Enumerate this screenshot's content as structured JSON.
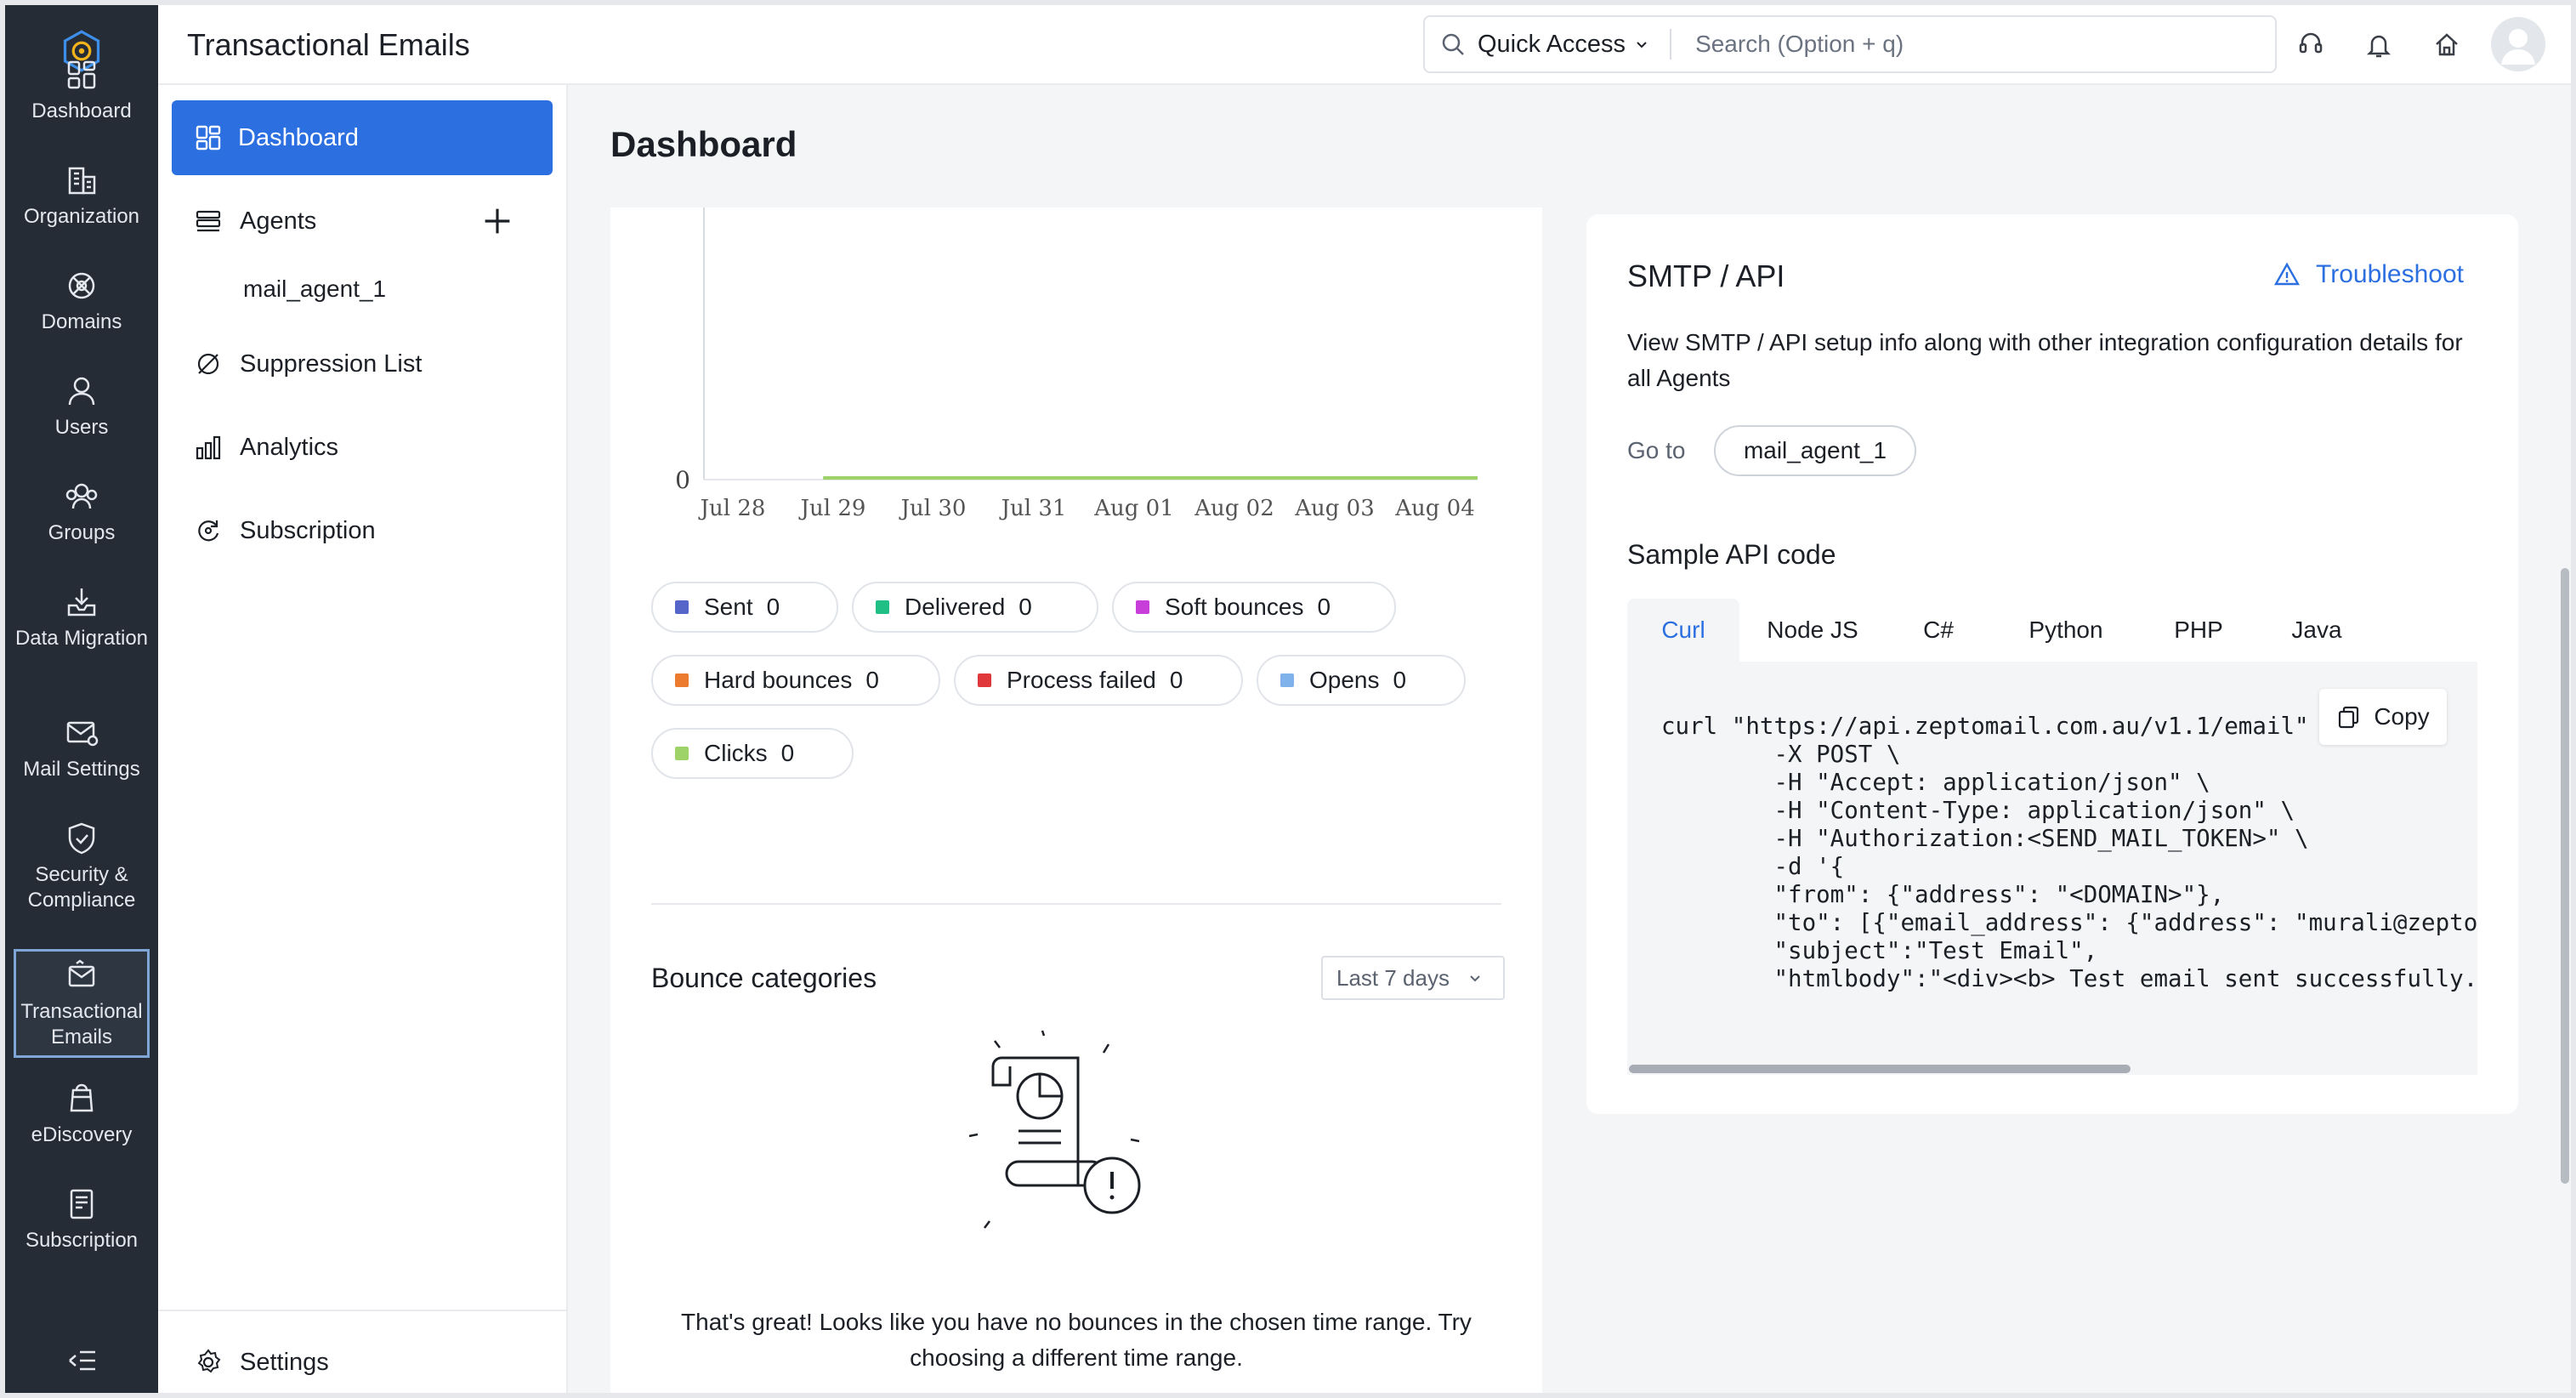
{
  "header": {
    "title": "Transactional Emails",
    "quick_access": "Quick Access",
    "search_placeholder": "Search (Option + q)"
  },
  "rail": {
    "items": [
      {
        "label": "Dashboard",
        "icon": "dashboard-icon"
      },
      {
        "label": "Organization",
        "icon": "organization-icon"
      },
      {
        "label": "Domains",
        "icon": "domains-icon"
      },
      {
        "label": "Users",
        "icon": "users-icon"
      },
      {
        "label": "Groups",
        "icon": "groups-icon"
      },
      {
        "label": "Data Migration",
        "icon": "data-migration-icon"
      },
      {
        "label": "Mail Settings",
        "icon": "mail-settings-icon"
      },
      {
        "label": "Security & Compliance",
        "icon": "security-icon"
      },
      {
        "label": "Transactional Emails",
        "icon": "transactional-emails-icon",
        "active": true
      },
      {
        "label": "eDiscovery",
        "icon": "ediscovery-icon"
      },
      {
        "label": "Subscription",
        "icon": "subscription-icon"
      }
    ]
  },
  "subnav": {
    "dashboard": "Dashboard",
    "agents": "Agents",
    "agent_1": "mail_agent_1",
    "suppression": "Suppression List",
    "analytics": "Analytics",
    "subscription": "Subscription",
    "settings": "Settings"
  },
  "main": {
    "title": "Dashboard"
  },
  "chart_data": {
    "type": "line",
    "categories": [
      "Jul 28",
      "Jul 29",
      "Jul 30",
      "Jul 31",
      "Aug 01",
      "Aug 02",
      "Aug 03",
      "Aug 04"
    ],
    "y_tick_labels": [
      "0"
    ],
    "series": [
      {
        "name": "Clicks",
        "color": "#9ed36a",
        "values": [
          null,
          0,
          0,
          0,
          0,
          0,
          0,
          0
        ]
      }
    ],
    "legend": [
      {
        "name": "Sent",
        "count": "0",
        "color": "#5566c8"
      },
      {
        "name": "Delivered",
        "count": "0",
        "color": "#1fbf86"
      },
      {
        "name": "Soft bounces",
        "count": "0",
        "color": "#c73ed8"
      },
      {
        "name": "Hard bounces",
        "count": "0",
        "color": "#ec7a2f"
      },
      {
        "name": "Process failed",
        "count": "0",
        "color": "#e0383a"
      },
      {
        "name": "Opens",
        "count": "0",
        "color": "#7fb2ea"
      },
      {
        "name": "Clicks",
        "count": "0",
        "color": "#9ed36a"
      }
    ]
  },
  "bounce": {
    "title": "Bounce categories",
    "range": "Last 7 days",
    "empty_message": "That's great! Looks like you have no bounces in the chosen time range. Try choosing a different time range."
  },
  "smtp": {
    "title": "SMTP / API",
    "troubleshoot": "Troubleshoot",
    "description": "View SMTP / API setup info along with other integration configuration details for all Agents",
    "goto_label": "Go to",
    "agent_chip": "mail_agent_1",
    "sample_title": "Sample API code",
    "tabs": [
      "Curl",
      "Node JS",
      "C#",
      "Python",
      "PHP",
      "Java"
    ],
    "copy_label": "Copy",
    "code": "curl \"https://api.zeptomail.com.au/v1.1/email\" \\\n        -X POST \\\n        -H \"Accept: application/json\" \\\n        -H \"Content-Type: application/json\" \\\n        -H \"Authorization:<SEND_MAIL_TOKEN>\" \\\n        -d '{\n        \"from\": {\"address\": \"<DOMAIN>\"},\n        \"to\": [{\"email_address\": {\"address\": \"murali@zepto\n        \"subject\":\"Test Email\",\n        \"htmlbody\":\"<div><b> Test email sent successfully."
  }
}
